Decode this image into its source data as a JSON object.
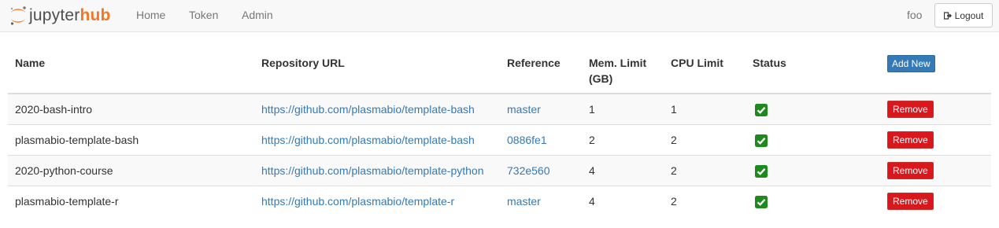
{
  "navbar": {
    "logo": {
      "text_part1": "jupyter",
      "text_part2": "hub"
    },
    "links": [
      "Home",
      "Token",
      "Admin"
    ],
    "user": "foo",
    "logout_label": "Logout"
  },
  "table": {
    "headers": {
      "name": "Name",
      "url": "Repository URL",
      "reference": "Reference",
      "mem_line1": "Mem. Limit",
      "mem_line2": "(GB)",
      "cpu": "CPU Limit",
      "status": "Status",
      "add_new": "Add New"
    },
    "remove_label": "Remove",
    "rows": [
      {
        "name": "2020-bash-intro",
        "url": "https://github.com/plasmabio/template-bash",
        "reference": "master",
        "mem": "1",
        "cpu": "1",
        "status": "ok"
      },
      {
        "name": "plasmabio-template-bash",
        "url": "https://github.com/plasmabio/template-bash",
        "reference": "0886fe1",
        "mem": "2",
        "cpu": "2",
        "status": "ok"
      },
      {
        "name": "2020-python-course",
        "url": "https://github.com/plasmabio/template-python",
        "reference": "732e560",
        "mem": "4",
        "cpu": "2",
        "status": "ok"
      },
      {
        "name": "plasmabio-template-r",
        "url": "https://github.com/plasmabio/template-r",
        "reference": "master",
        "mem": "4",
        "cpu": "2",
        "status": "ok"
      }
    ]
  },
  "colors": {
    "link": "#337ab7",
    "add_button": "#337ab7",
    "remove_button": "#d9181e",
    "status_ok": "#1e8a1e",
    "brand_orange": "#f37726"
  },
  "icons": {
    "logo": "jupyter-logo-icon",
    "logout": "sign-out-icon",
    "status_ok": "check-square-icon"
  }
}
